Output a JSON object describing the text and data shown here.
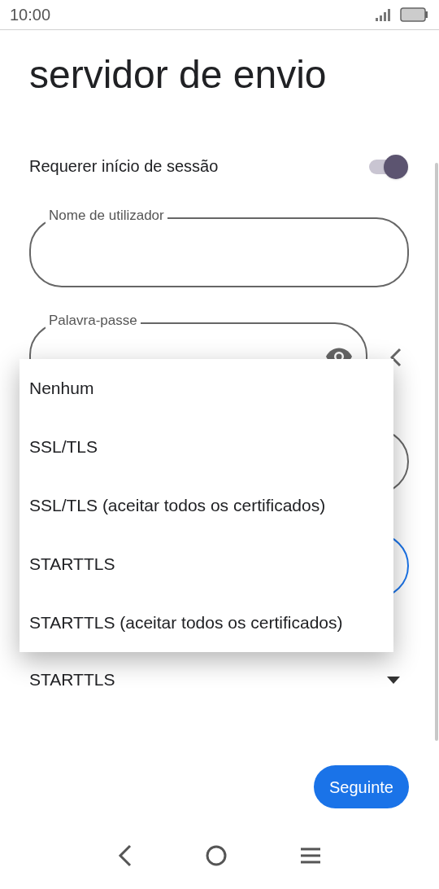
{
  "status_bar": {
    "time": "10:00"
  },
  "title": "servidor de envio",
  "require_signin": {
    "label": "Requerer início de sessão",
    "on": true
  },
  "fields": [
    {
      "kind": "text",
      "label": "Nome de utilizador"
    },
    {
      "kind": "password",
      "label": "Palavra-passe"
    }
  ],
  "security_field": {
    "value": "STARTTLS"
  },
  "security_menu": {
    "items": [
      "Nenhum",
      "SSL/TLS",
      "SSL/TLS (aceitar todos os certificados)",
      "STARTTLS",
      "STARTTLS (aceitar todos os certificados)"
    ]
  },
  "next_button": "Seguinte"
}
